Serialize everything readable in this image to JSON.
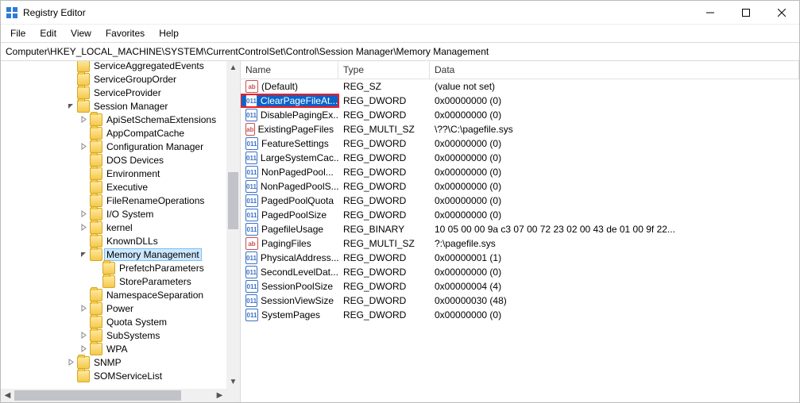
{
  "window": {
    "title": "Registry Editor"
  },
  "menu": [
    "File",
    "Edit",
    "View",
    "Favorites",
    "Help"
  ],
  "address": "Computer\\HKEY_LOCAL_MACHINE\\SYSTEM\\CurrentControlSet\\Control\\Session Manager\\Memory Management",
  "tree": [
    {
      "indent": 5,
      "exp": "",
      "label": "ServiceAggregatedEvents"
    },
    {
      "indent": 5,
      "exp": "",
      "label": "ServiceGroupOrder"
    },
    {
      "indent": 5,
      "exp": "",
      "label": "ServiceProvider"
    },
    {
      "indent": 5,
      "exp": "v",
      "label": "Session Manager"
    },
    {
      "indent": 6,
      "exp": ">",
      "label": "ApiSetSchemaExtensions"
    },
    {
      "indent": 6,
      "exp": "",
      "label": "AppCompatCache"
    },
    {
      "indent": 6,
      "exp": ">",
      "label": "Configuration Manager"
    },
    {
      "indent": 6,
      "exp": "",
      "label": "DOS Devices"
    },
    {
      "indent": 6,
      "exp": "",
      "label": "Environment"
    },
    {
      "indent": 6,
      "exp": "",
      "label": "Executive"
    },
    {
      "indent": 6,
      "exp": "",
      "label": "FileRenameOperations"
    },
    {
      "indent": 6,
      "exp": ">",
      "label": "I/O System"
    },
    {
      "indent": 6,
      "exp": ">",
      "label": "kernel"
    },
    {
      "indent": 6,
      "exp": "",
      "label": "KnownDLLs"
    },
    {
      "indent": 6,
      "exp": "v",
      "label": "Memory Management",
      "selected": true
    },
    {
      "indent": 7,
      "exp": "",
      "label": "PrefetchParameters"
    },
    {
      "indent": 7,
      "exp": "",
      "label": "StoreParameters"
    },
    {
      "indent": 6,
      "exp": "",
      "label": "NamespaceSeparation"
    },
    {
      "indent": 6,
      "exp": ">",
      "label": "Power"
    },
    {
      "indent": 6,
      "exp": "",
      "label": "Quota System"
    },
    {
      "indent": 6,
      "exp": ">",
      "label": "SubSystems"
    },
    {
      "indent": 6,
      "exp": ">",
      "label": "WPA"
    },
    {
      "indent": 5,
      "exp": ">",
      "label": "SNMP"
    },
    {
      "indent": 5,
      "exp": "",
      "label": "SOMServiceList"
    }
  ],
  "columns": {
    "name": "Name",
    "type": "Type",
    "data": "Data"
  },
  "values": [
    {
      "icon": "ab",
      "name": "(Default)",
      "type": "REG_SZ",
      "data": "(value not set)"
    },
    {
      "icon": "num",
      "name": "ClearPageFileAt...",
      "type": "REG_DWORD",
      "data": "0x00000000 (0)",
      "selected": true,
      "highlight": true
    },
    {
      "icon": "num",
      "name": "DisablePagingEx...",
      "type": "REG_DWORD",
      "data": "0x00000000 (0)"
    },
    {
      "icon": "ab",
      "name": "ExistingPageFiles",
      "type": "REG_MULTI_SZ",
      "data": "\\??\\C:\\pagefile.sys"
    },
    {
      "icon": "num",
      "name": "FeatureSettings",
      "type": "REG_DWORD",
      "data": "0x00000000 (0)"
    },
    {
      "icon": "num",
      "name": "LargeSystemCac...",
      "type": "REG_DWORD",
      "data": "0x00000000 (0)"
    },
    {
      "icon": "num",
      "name": "NonPagedPool...",
      "type": "REG_DWORD",
      "data": "0x00000000 (0)"
    },
    {
      "icon": "num",
      "name": "NonPagedPoolS...",
      "type": "REG_DWORD",
      "data": "0x00000000 (0)"
    },
    {
      "icon": "num",
      "name": "PagedPoolQuota",
      "type": "REG_DWORD",
      "data": "0x00000000 (0)"
    },
    {
      "icon": "num",
      "name": "PagedPoolSize",
      "type": "REG_DWORD",
      "data": "0x00000000 (0)"
    },
    {
      "icon": "num",
      "name": "PagefileUsage",
      "type": "REG_BINARY",
      "data": "10 05 00 00 9a c3 07 00 72 23 02 00 43 de 01 00 9f 22..."
    },
    {
      "icon": "ab",
      "name": "PagingFiles",
      "type": "REG_MULTI_SZ",
      "data": "?:\\pagefile.sys"
    },
    {
      "icon": "num",
      "name": "PhysicalAddress...",
      "type": "REG_DWORD",
      "data": "0x00000001 (1)"
    },
    {
      "icon": "num",
      "name": "SecondLevelDat...",
      "type": "REG_DWORD",
      "data": "0x00000000 (0)"
    },
    {
      "icon": "num",
      "name": "SessionPoolSize",
      "type": "REG_DWORD",
      "data": "0x00000004 (4)"
    },
    {
      "icon": "num",
      "name": "SessionViewSize",
      "type": "REG_DWORD",
      "data": "0x00000030 (48)"
    },
    {
      "icon": "num",
      "name": "SystemPages",
      "type": "REG_DWORD",
      "data": "0x00000000 (0)"
    }
  ]
}
